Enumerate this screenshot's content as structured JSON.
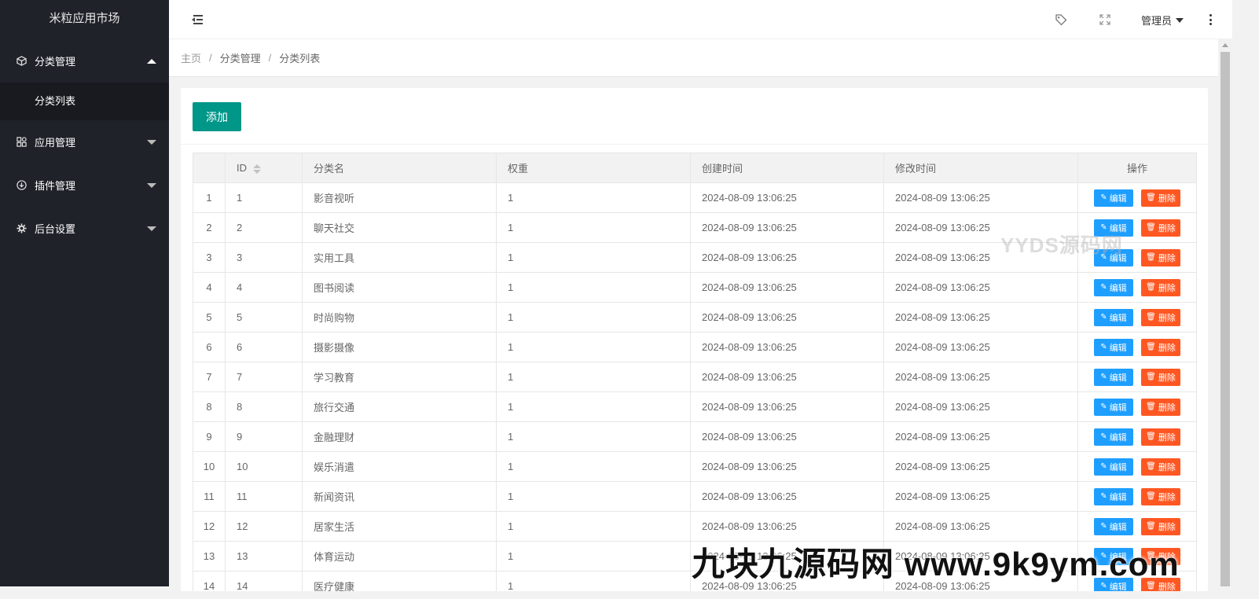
{
  "app": {
    "title": "米粒应用市场"
  },
  "sidebar": {
    "items": [
      {
        "label": "分类管理",
        "icon": "box-icon",
        "expanded": true,
        "children": [
          {
            "label": "分类列表"
          }
        ]
      },
      {
        "label": "应用管理",
        "icon": "apps-icon",
        "expanded": false
      },
      {
        "label": "插件管理",
        "icon": "download-icon",
        "expanded": false
      },
      {
        "label": "后台设置",
        "icon": "gear-icon",
        "expanded": false
      }
    ]
  },
  "header": {
    "user": "管理员",
    "icons": [
      "menu-toggle-icon",
      "tag-icon",
      "fullscreen-icon",
      "more-icon"
    ]
  },
  "breadcrumb": [
    "主页",
    "分类管理",
    "分类列表"
  ],
  "toolbar": {
    "add_label": "添加"
  },
  "table": {
    "columns": [
      "",
      "ID",
      "分类名",
      "权重",
      "创建时间",
      "修改时间",
      "操作"
    ],
    "edit_label": "编辑",
    "delete_label": "删除",
    "rows": [
      {
        "idx": "1",
        "id": "1",
        "name": "影音视听",
        "weight": "1",
        "created": "2024-08-09 13:06:25",
        "modified": "2024-08-09 13:06:25"
      },
      {
        "idx": "2",
        "id": "2",
        "name": "聊天社交",
        "weight": "1",
        "created": "2024-08-09 13:06:25",
        "modified": "2024-08-09 13:06:25"
      },
      {
        "idx": "3",
        "id": "3",
        "name": "实用工具",
        "weight": "1",
        "created": "2024-08-09 13:06:25",
        "modified": "2024-08-09 13:06:25"
      },
      {
        "idx": "4",
        "id": "4",
        "name": "图书阅读",
        "weight": "1",
        "created": "2024-08-09 13:06:25",
        "modified": "2024-08-09 13:06:25"
      },
      {
        "idx": "5",
        "id": "5",
        "name": "时尚购物",
        "weight": "1",
        "created": "2024-08-09 13:06:25",
        "modified": "2024-08-09 13:06:25"
      },
      {
        "idx": "6",
        "id": "6",
        "name": "摄影摄像",
        "weight": "1",
        "created": "2024-08-09 13:06:25",
        "modified": "2024-08-09 13:06:25"
      },
      {
        "idx": "7",
        "id": "7",
        "name": "学习教育",
        "weight": "1",
        "created": "2024-08-09 13:06:25",
        "modified": "2024-08-09 13:06:25"
      },
      {
        "idx": "8",
        "id": "8",
        "name": "旅行交通",
        "weight": "1",
        "created": "2024-08-09 13:06:25",
        "modified": "2024-08-09 13:06:25"
      },
      {
        "idx": "9",
        "id": "9",
        "name": "金融理财",
        "weight": "1",
        "created": "2024-08-09 13:06:25",
        "modified": "2024-08-09 13:06:25"
      },
      {
        "idx": "10",
        "id": "10",
        "name": "娱乐消遣",
        "weight": "1",
        "created": "2024-08-09 13:06:25",
        "modified": "2024-08-09 13:06:25"
      },
      {
        "idx": "11",
        "id": "11",
        "name": "新闻资讯",
        "weight": "1",
        "created": "2024-08-09 13:06:25",
        "modified": "2024-08-09 13:06:25"
      },
      {
        "idx": "12",
        "id": "12",
        "name": "居家生活",
        "weight": "1",
        "created": "2024-08-09 13:06:25",
        "modified": "2024-08-09 13:06:25"
      },
      {
        "idx": "13",
        "id": "13",
        "name": "体育运动",
        "weight": "1",
        "created": "2024-08-09 13:06:25",
        "modified": "2024-08-09 13:06:25"
      },
      {
        "idx": "14",
        "id": "14",
        "name": "医疗健康",
        "weight": "1",
        "created": "2024-08-09 13:06:25",
        "modified": "2024-08-09 13:06:25"
      }
    ]
  },
  "watermarks": {
    "top": "YYDS源码网",
    "bottom": "九块九源码网 www.9k9ym.com"
  },
  "colors": {
    "sidebar_bg": "#20222a",
    "add_button": "#009688",
    "edit_button": "#1e9fff",
    "delete_button": "#ff5722"
  }
}
